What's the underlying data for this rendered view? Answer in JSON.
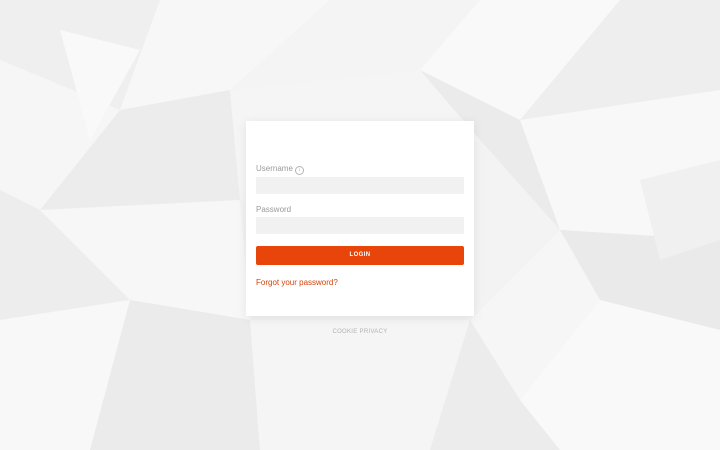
{
  "colors": {
    "accent": "#e8450a",
    "link": "#d4420a",
    "background": "#f3f3f3",
    "card": "#ffffff",
    "input_bg": "#f1f1f1"
  },
  "login_form": {
    "username_label": "Username",
    "username_info_icon": "info-icon",
    "username_value": "",
    "password_label": "Password",
    "password_value": "",
    "login_button_label": "LOGIN",
    "forgot_password_link": "Forgot your password?"
  },
  "footer": {
    "cookie_link": "COOKIE",
    "privacy_link": "PRIVACY"
  }
}
